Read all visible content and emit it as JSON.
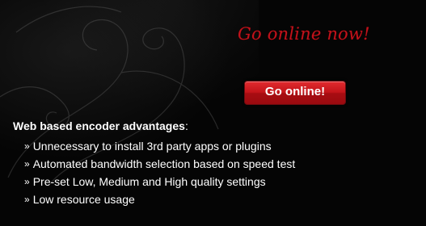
{
  "promo": {
    "tagline": "Go online now!",
    "button_label": "Go online!"
  },
  "advantages": {
    "title_bold": "Web based encoder advantages",
    "title_suffix": ":",
    "bullet": "»",
    "items": [
      "Unnecessary to install 3rd party apps or plugins",
      "Automated bandwidth selection based on speed test",
      "Pre-set Low, Medium and High quality settings",
      "Low resource usage"
    ]
  },
  "colors": {
    "background": "#050505",
    "accent_red": "#c1121b",
    "button_red": "#c3141a",
    "text": "#ffffff"
  },
  "icons": {
    "ornament": "floral-swirl-ornament"
  }
}
